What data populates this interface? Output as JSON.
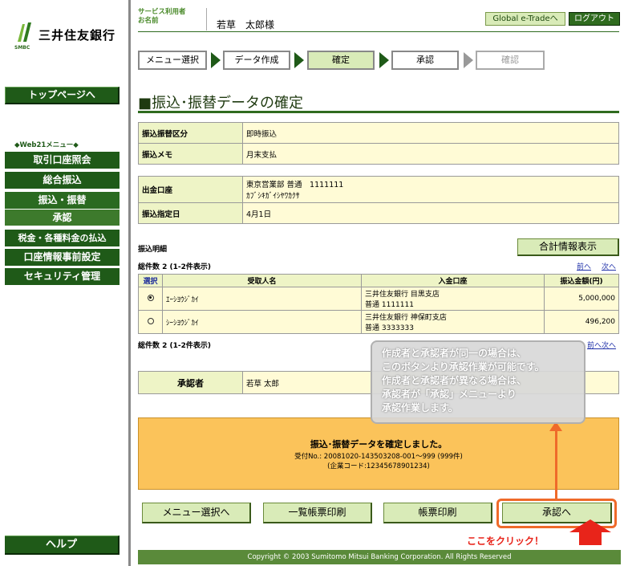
{
  "brand": {
    "name": "三井住友銀行",
    "sub": "SMBC",
    "color": "#1f5a18"
  },
  "sidebar": {
    "top_button": "トップページへ",
    "web21_label": "◆Web21メニュー◆",
    "items": [
      {
        "label": "取引口座照会"
      },
      {
        "label": "総合振込"
      },
      {
        "label": "振込・振替"
      },
      {
        "label": "承認"
      },
      {
        "label": "税金・各種料金の払込"
      },
      {
        "label": "口座情報事前設定"
      },
      {
        "label": "セキュリティ管理"
      }
    ],
    "help_button": "ヘルプ"
  },
  "header": {
    "user_label": "サービス利用者\nお名前",
    "user_name": "若草　太郎様",
    "global_button": "Global e-Tradeへ",
    "logout_button": "ログアウト"
  },
  "steps": [
    {
      "label": "メニュー選択"
    },
    {
      "label": "データ作成"
    },
    {
      "label": "確定"
    },
    {
      "label": "承認"
    },
    {
      "label": "確認"
    }
  ],
  "page_title": "■振込･振替データの確定",
  "form1": {
    "rows": [
      {
        "label": "振込振替区分",
        "value": "即時振込"
      },
      {
        "label": "振込メモ",
        "value": "月末支払"
      }
    ]
  },
  "form2": {
    "rows": [
      {
        "label": "出金口座",
        "value_line1": "東京営業部 普通　1111111",
        "value_line2": "ｶﾌﾞｼｷｶﾞｲｼﾔﾜｶｸｻ"
      },
      {
        "label": "振込指定日",
        "value_line1": "4月1日",
        "value_line2": ""
      }
    ]
  },
  "detail": {
    "section_label": "振込明細",
    "total_button": "合計情報表示",
    "count_text": "総件数 2 (1-2件表示)",
    "prev": "前へ",
    "next": "次へ",
    "headers": [
      "選択",
      "受取人名",
      "入金口座",
      "振込金額(円)"
    ],
    "rows": [
      {
        "selected": true,
        "payee": "ｴｰｼﾖｳｼﾞｶｲ",
        "bank_line1": "三井住友銀行 目黒支店",
        "bank_line2": "普通 1111111",
        "amount": "5,000,000"
      },
      {
        "selected": false,
        "payee": "ｼｰｼﾖｳｼﾞｶｲ",
        "bank_line1": "三井住友銀行 神保町支店",
        "bank_line2": "普通 3333333",
        "amount": "496,200"
      }
    ]
  },
  "approver": {
    "label": "承認者",
    "value": "若草 太郎"
  },
  "notice": {
    "title": "振込･振替データを確定しました。",
    "line1": "受付No.: 20081020-143503208-001～999 (999件)",
    "line2": "(企業コード:12345678901234)"
  },
  "buttons": {
    "menu": "メニュー選択へ",
    "list_print": "一覧帳票印刷",
    "print": "帳票印刷",
    "approve": "承認へ"
  },
  "callout": {
    "lines": [
      "作成者と承認者が同一の場合は、",
      "このボタンより承認作業が可能です。",
      "作成者と承認者が異なる場合は、",
      "承認者が「承認」メニューより",
      "承認作業します。"
    ]
  },
  "click_label": "ここをクリック！",
  "footer": "Copyright © 2003 Sumitomo Mitsui Banking Corporation. All Rights Reserved",
  "colors": {
    "accent_orange": "#ef6a2a",
    "notice_bg": "#fbc35a",
    "click_red": "#e8241a"
  }
}
